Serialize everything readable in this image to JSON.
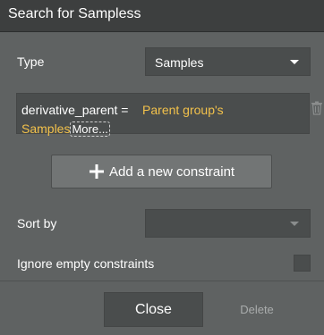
{
  "dialog": {
    "title": "Search for Sampless"
  },
  "type_row": {
    "label": "Type",
    "value": "Samples"
  },
  "constraint": {
    "field": "derivative_parent =",
    "value_part1": "Parent group's",
    "value_part2": "Samples",
    "more_label": "More..."
  },
  "add_constraint": {
    "label": "Add a new constraint"
  },
  "sort_row": {
    "label": "Sort by",
    "value": ""
  },
  "ignore_row": {
    "label": "Ignore empty constraints",
    "checked": false
  },
  "footer": {
    "close_label": "Close",
    "delete_label": "Delete"
  },
  "colors": {
    "background": "#5f6262",
    "titlebar": "#3d3f3f",
    "dynamic_value": "#f2c14b"
  }
}
